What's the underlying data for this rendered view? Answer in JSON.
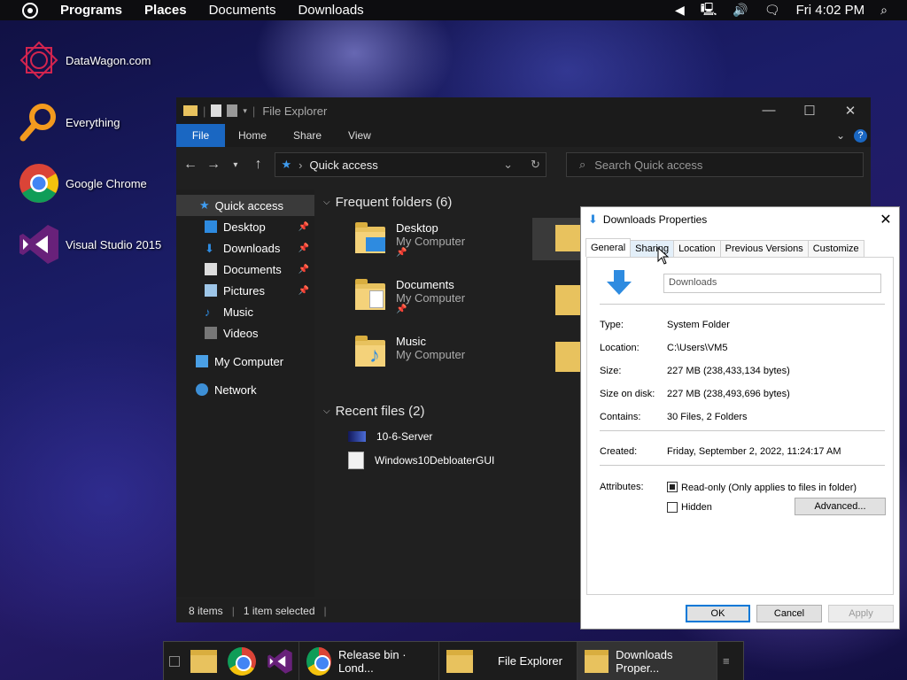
{
  "topbar": {
    "menu": [
      "Programs",
      "Places",
      "Documents",
      "Downloads"
    ],
    "clock": "Fri 4:02 PM"
  },
  "desktop": {
    "icons": [
      {
        "label": "DataWagon.com",
        "icon": "datawagon-icon"
      },
      {
        "label": "Everything",
        "icon": "magnifier-icon"
      },
      {
        "label": "Google Chrome",
        "icon": "chrome-icon"
      },
      {
        "label": "Visual Studio 2015",
        "icon": "visual-studio-icon"
      }
    ]
  },
  "explorer": {
    "title": "File Explorer",
    "ribbon_tabs": [
      "File",
      "Home",
      "Share",
      "View"
    ],
    "address": "Quick access",
    "search_placeholder": "Search Quick access",
    "nav": {
      "quick_access": "Quick access",
      "items": [
        "Desktop",
        "Downloads",
        "Documents",
        "Pictures",
        "Music",
        "Videos"
      ],
      "my_computer": "My Computer",
      "network": "Network"
    },
    "frequent_header": "Frequent folders (6)",
    "frequent": [
      {
        "name": "Desktop",
        "location": "My Computer"
      },
      {
        "name": "Documents",
        "location": "My Computer"
      },
      {
        "name": "Music",
        "location": "My Computer"
      }
    ],
    "recent_header": "Recent files (2)",
    "recent": [
      "10-6-Server",
      "Windows10DebloaterGUI"
    ],
    "status": {
      "items": "8 items",
      "selected": "1 item selected"
    }
  },
  "properties": {
    "title": "Downloads Properties",
    "tabs": [
      "General",
      "Sharing",
      "Location",
      "Previous Versions",
      "Customize"
    ],
    "name": "Downloads",
    "fields": [
      {
        "label": "Type:",
        "value": "System Folder"
      },
      {
        "label": "Location:",
        "value": "C:\\Users\\VM5"
      },
      {
        "label": "Size:",
        "value": "227 MB (238,433,134 bytes)"
      },
      {
        "label": "Size on disk:",
        "value": "227 MB (238,493,696 bytes)"
      },
      {
        "label": "Contains:",
        "value": "30 Files, 2 Folders"
      }
    ],
    "created_label": "Created:",
    "created_value": "Friday, September 2, 2022, 11:24:17 AM",
    "attributes_label": "Attributes:",
    "readonly_label": "Read-only (Only applies to files in folder)",
    "hidden_label": "Hidden",
    "advanced_label": "Advanced...",
    "ok_label": "OK",
    "cancel_label": "Cancel",
    "apply_label": "Apply"
  },
  "taskbar": {
    "windows": [
      "Release bin · Lond...",
      "File Explorer",
      "Downloads Proper..."
    ]
  }
}
